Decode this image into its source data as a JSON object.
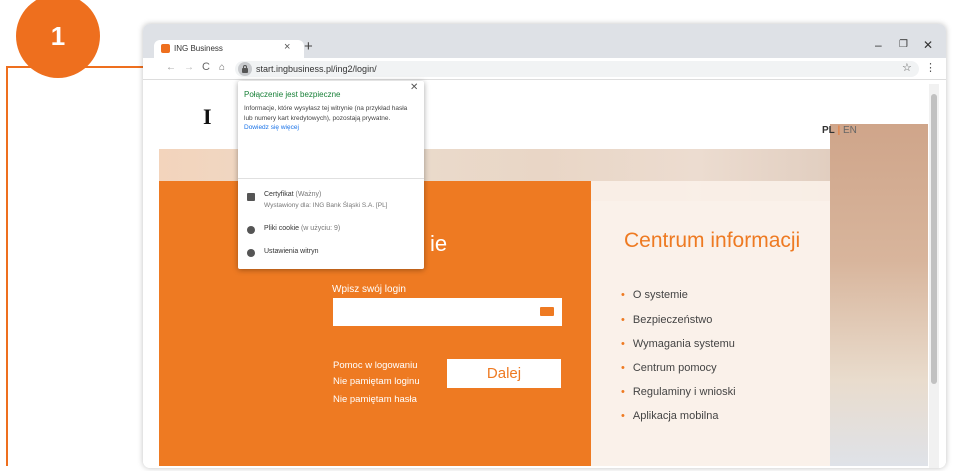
{
  "step": {
    "number": "1"
  },
  "browser": {
    "tab_title": "ING Business",
    "url": "start.ingbusiness.pl/ing2/login/"
  },
  "page": {
    "logo": "I",
    "lang_pl": "PL",
    "lang_sep": "|",
    "lang_en": "EN",
    "login_heading": "ie",
    "login_label": "Wpisz swój login",
    "help_links": [
      "Pomoc w logowaniu",
      "Nie pamiętam loginu",
      "Nie pamiętam hasła"
    ],
    "next_button": "Dalej",
    "info_title": "Centrum informacji",
    "info_items": [
      "O systemie",
      "Bezpieczeństwo",
      "Wymagania systemu",
      "Centrum pomocy",
      "Regulaminy i wnioski",
      "Aplikacja mobilna"
    ]
  },
  "popup": {
    "title": "Połączenie jest bezpieczne",
    "desc": "Informacje, które wysyłasz tej witrynie (na przykład hasła lub numery kart kredytowych), pozostają prywatne.",
    "link": "Dowiedz się więcej",
    "cert_label": "Certyfikat",
    "cert_status": "(Ważny)",
    "cert_issued": "Wystawiony dla: ING Bank Śląski S.A. [PL]",
    "cookies_label": "Pliki cookie",
    "cookies_count": "(w użyciu: 9)",
    "site_settings": "Ustawienia witryn"
  },
  "colors": {
    "accent": "#ee6f1e",
    "secure_green": "#188038",
    "link_blue": "#1a73e8"
  }
}
